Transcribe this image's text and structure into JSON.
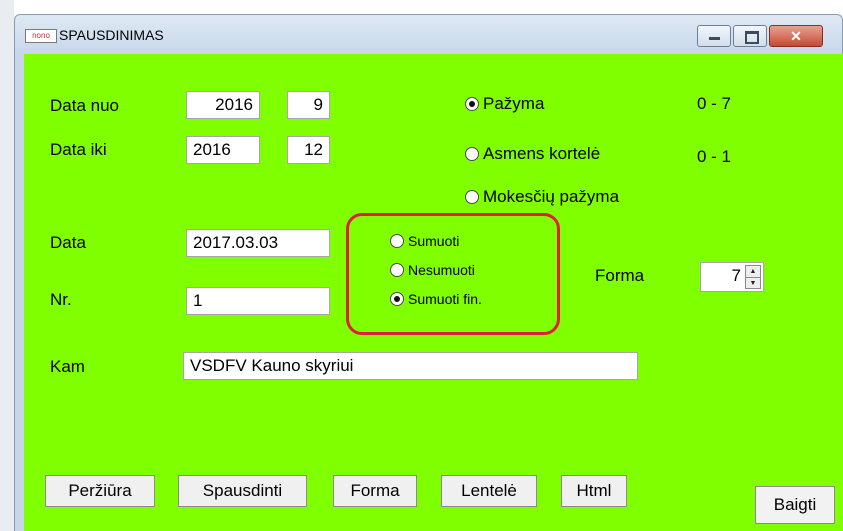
{
  "window": {
    "app_icon_text": "nono",
    "title": "SPAUSDINIMAS",
    "minimize_label": "",
    "maximize_label": "",
    "close_label": "✕"
  },
  "dates": {
    "from_label": "Data nuo",
    "from_year": "2016",
    "from_month": "9",
    "to_label": "Data iki",
    "to_year": "2016",
    "to_month": "12"
  },
  "doc_type": {
    "options": [
      {
        "label": "Pažyma",
        "range": "0 - 7",
        "selected": true
      },
      {
        "label": "Asmens kortelė",
        "range": "0 - 1",
        "selected": false
      },
      {
        "label": "Mokesčių pažyma",
        "range": "",
        "selected": false
      }
    ]
  },
  "form": {
    "date_label": "Data",
    "date_value": "2017.03.03",
    "nr_label": "Nr.",
    "nr_value": "1",
    "to_label": "Kam",
    "to_value": "VSDFV Kauno skyriui",
    "forma_label": "Forma",
    "forma_value": "7"
  },
  "sum_mode": {
    "options": [
      {
        "label": "Sumuoti",
        "selected": false
      },
      {
        "label": "Nesumuoti",
        "selected": false
      },
      {
        "label": "Sumuoti fin.",
        "selected": true
      }
    ],
    "highlight_color": "#e0203a"
  },
  "buttons": {
    "preview": "Peržiūra",
    "print": "Spausdinti",
    "form": "Forma",
    "table": "Lentelė",
    "html": "Html",
    "finish": "Baigti"
  },
  "colors": {
    "background": "#80ff00"
  }
}
